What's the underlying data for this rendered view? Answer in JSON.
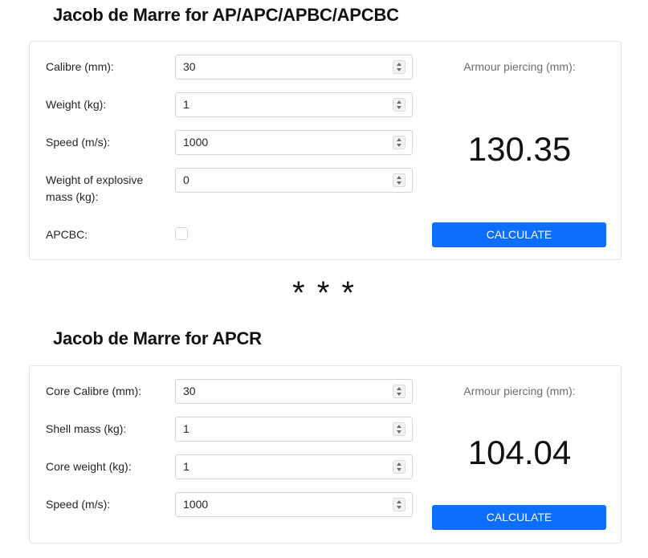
{
  "section1": {
    "title": "Jacob de Marre for AP/APC/APBC/APCBC",
    "fields": [
      {
        "label": "Calibre (mm):",
        "value": "30"
      },
      {
        "label": "Weight (kg):",
        "value": "1"
      },
      {
        "label": "Speed (m/s):",
        "value": "1000"
      },
      {
        "label": "Weight of explosive mass (kg):",
        "value": "0"
      }
    ],
    "checkbox_label": "APCBC:",
    "checkbox_checked": false,
    "result_label": "Armour piercing (mm):",
    "result_value": "130.35",
    "button_label": "CALCULATE"
  },
  "separator": "* * *",
  "section2": {
    "title": "Jacob de Marre for APCR",
    "fields": [
      {
        "label": "Core Calibre (mm):",
        "value": "30"
      },
      {
        "label": "Shell mass (kg):",
        "value": "1"
      },
      {
        "label": "Core weight (kg):",
        "value": "1"
      },
      {
        "label": "Speed (m/s):",
        "value": "1000"
      }
    ],
    "result_label": "Armour piercing (mm):",
    "result_value": "104.04",
    "button_label": "CALCULATE"
  },
  "colors": {
    "primary_button": "#0d6efd",
    "card_border": "#dfe2e6",
    "input_border": "#ced4da"
  }
}
